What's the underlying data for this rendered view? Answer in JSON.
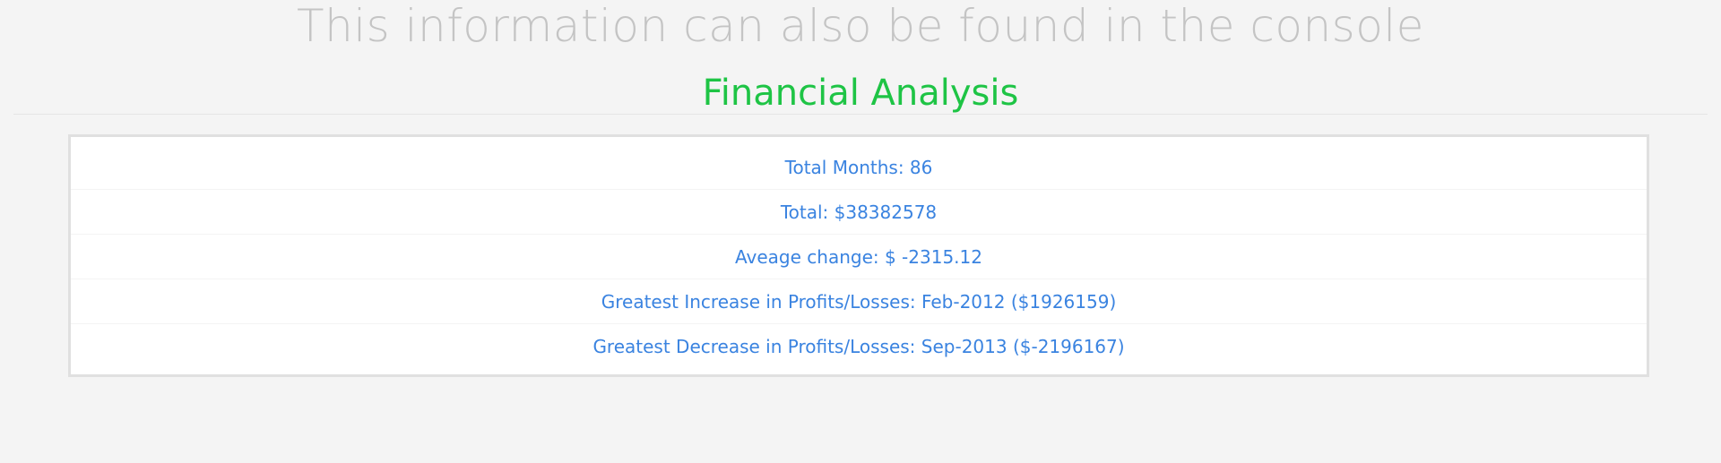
{
  "header": {
    "console_note": "This information can also be found in the console",
    "title": "Financial Analysis"
  },
  "summary": {
    "rows": [
      "Total Months: 86",
      "Total: $38382578",
      "Aveage change: $ -2315.12",
      "Greatest Increase in Profits/Losses: Feb-2012 ($1926159)",
      "Greatest Decrease in Profits/Losses: Sep-2013 ($-2196167)"
    ]
  },
  "colors": {
    "background": "#f4f4f4",
    "note_text": "#c4c4c4",
    "title_green": "#1ec445",
    "row_blue": "#3a83e0",
    "panel_border": "#e0e0e0"
  }
}
